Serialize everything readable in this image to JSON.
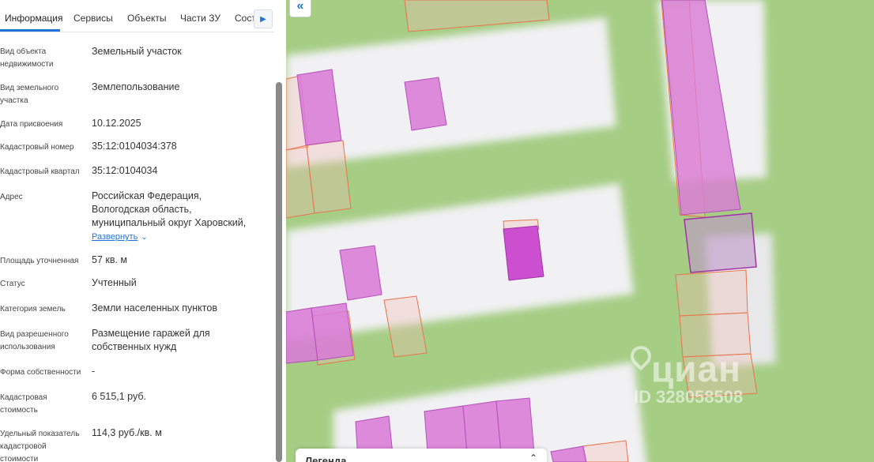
{
  "tabs": [
    "Информация",
    "Сервисы",
    "Объекты",
    "Части ЗУ",
    "Сост"
  ],
  "tabs_next_icon": "caret-right-icon",
  "fields": [
    {
      "label": "Вид объекта недвижимости",
      "value": "Земельный участок"
    },
    {
      "label": "Вид земельного участка",
      "value": "Землепользование"
    },
    {
      "label": "Дата присвоения",
      "value": "10.12.2025"
    },
    {
      "label": "Кадастровый номер",
      "value": "35:12:0104034:378"
    },
    {
      "label": "Кадастровый квартал",
      "value": "35:12:0104034"
    },
    {
      "label": "Адрес",
      "value": "Российская Федерация, Вологодская область, муниципальный округ Харовский,"
    },
    {
      "label": "Площадь уточненная",
      "value": "57 кв. м"
    },
    {
      "label": "Статус",
      "value": "Учтенный"
    },
    {
      "label": "Категория земель",
      "value": "Земли населенных пунктов"
    },
    {
      "label": "Вид разрешенного использования",
      "value": "Размещение гаражей для собственных нужд"
    },
    {
      "label": "Форма собственности",
      "value": "-"
    },
    {
      "label": "Кадастровая стоимость",
      "value": "6 515,1 руб."
    },
    {
      "label": "Удельный показатель кадастровой стоимости",
      "value": "114,3 руб./кв. м"
    }
  ],
  "expand_label": "Развернуть",
  "map": {
    "collapse_icon": "double-chevron-left-icon",
    "legend_title": "Легенда",
    "legend_icon": "chevron-up-icon",
    "watermark_brand": "циан",
    "watermark_id": "ID 328058508",
    "colors": {
      "grass": "#a5cd84",
      "road": "#f1f0f3",
      "parcel_outline": "#e8744a",
      "building_fill": "#d97bd6",
      "selected_parcel": "#cc4fcf"
    }
  }
}
